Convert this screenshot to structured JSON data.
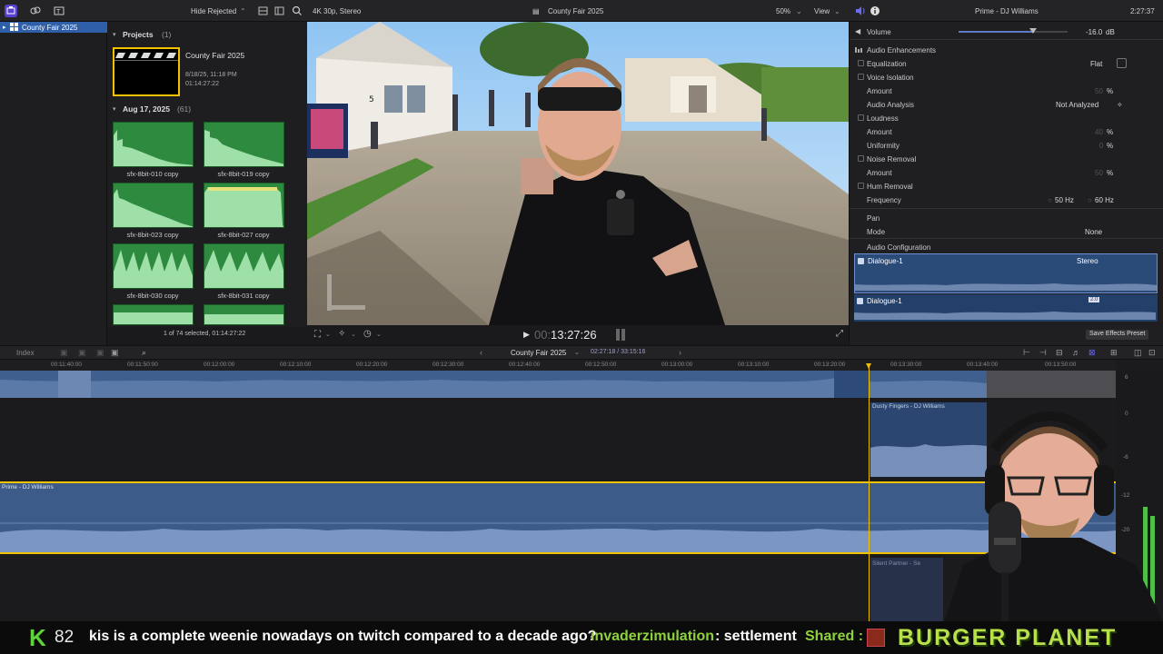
{
  "app": {
    "project_name": "County Fair 2025",
    "viewer_format": "4K 30p, Stereo",
    "viewer_zoom": "50%",
    "view_menu": "View",
    "hide_rejected": "Hide Rejected",
    "inspector_title": "Prime - DJ Williams",
    "inspector_time": "2:27:37"
  },
  "sidebar": {
    "items": [
      {
        "label": "County Fair 2025"
      }
    ]
  },
  "browser": {
    "projects_header": "Projects",
    "projects_count": "(1)",
    "project": {
      "name": "County Fair 2025",
      "date": "8/18/25, 11:18 PM",
      "duration": "01:14:27:22"
    },
    "event_header": "Aug 17, 2025",
    "event_count": "(61)",
    "clips": [
      {
        "label": "sfx-8bit-010 copy"
      },
      {
        "label": "sfx-8bit-019 copy"
      },
      {
        "label": "sfx-8bit-023 copy"
      },
      {
        "label": "sfx-8bit-027 copy"
      },
      {
        "label": "sfx-8bit-030 copy"
      },
      {
        "label": "sfx-8bit-031 copy"
      }
    ],
    "selection_status": "1 of 74 selected, 01:14:27:22"
  },
  "viewer": {
    "timecode": "13:27:26",
    "timecode_dim": "00:"
  },
  "inspector": {
    "volume_label": "Volume",
    "volume_value": "-16.0",
    "volume_unit": "dB",
    "volume_level": 0.68,
    "audio_enhancements": "Audio Enhancements",
    "equalization": "Equalization",
    "eq_value": "Flat",
    "voice_isolation": "Voice Isolation",
    "amount": "Amount",
    "amount_value": "50",
    "pct": "%",
    "audio_analysis": "Audio Analysis",
    "not_analyzed": "Not Analyzed",
    "loudness": "Loudness",
    "loudness_amount": "40",
    "uniformity": "Uniformity",
    "uniformity_value": "0",
    "noise_removal": "Noise Removal",
    "noise_amount": "50",
    "hum_removal": "Hum Removal",
    "frequency": "Frequency",
    "freq_50": "50 Hz",
    "freq_60": "60 Hz",
    "pan": "Pan",
    "mode": "Mode",
    "mode_value": "None",
    "audio_configuration": "Audio Configuration",
    "dialogue_1": "Dialogue-1",
    "stereo": "Stereo",
    "dialogue_1b": "Dialogue-1",
    "channel_badge": "2.0",
    "save_effects_preset": "Save Effects Preset"
  },
  "timeline_bar": {
    "index": "Index",
    "project": "County Fair 2025",
    "timecode": "02:27:18 / 33:15:16"
  },
  "timeline": {
    "ruler": [
      "00:11:40:00",
      "00:11:50:00",
      "00:12:00:00",
      "00:12:10:00",
      "00:12:20:00",
      "00:12:30:00",
      "00:12:40:00",
      "00:12:50:00",
      "00:13:00:00",
      "00:13:10:00",
      "00:13:20:00",
      "00:13:30:00",
      "00:13:40:00",
      "00:13:50:00"
    ],
    "clip_dusty": "Dusty Fingers - DJ Williams",
    "clip_prime": "Prime - DJ Williams",
    "clip_silent": "Silent Partner - Se",
    "meter_labels": [
      "6",
      "0",
      "-6",
      "-12",
      "-20"
    ]
  },
  "ticker": {
    "k_label": "K",
    "k_number": "82",
    "message": "kis is a complete weenie nowadays on twitch compared to a decade ago?",
    "user": "invaderzimulation",
    "user_msg": ": settlement",
    "shared": "Shared :",
    "brand": "BURGER PLANET"
  },
  "colors": {
    "selection_blue": "#2f5fa8",
    "clip_green": "#2d8a3e",
    "audio_blue": "#3f5f8f",
    "playhead_yellow": "#f2c200",
    "ticker_green": "#8fd13b"
  }
}
